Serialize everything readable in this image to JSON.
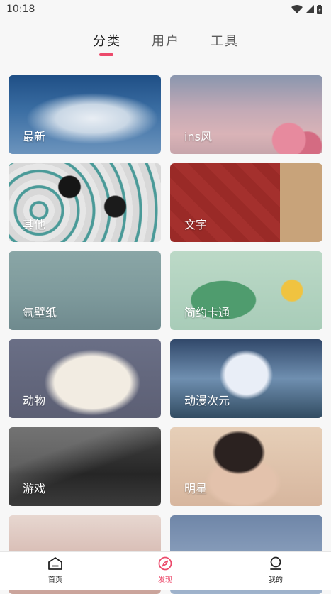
{
  "status_bar": {
    "time": "10:18"
  },
  "tabs": [
    {
      "label": "分类",
      "active": true
    },
    {
      "label": "用户",
      "active": false
    },
    {
      "label": "工具",
      "active": false
    }
  ],
  "colors": {
    "accent": "#ec4a6b"
  },
  "categories": [
    {
      "label": "最新"
    },
    {
      "label": "ins风"
    },
    {
      "label": "其他"
    },
    {
      "label": "文字"
    },
    {
      "label": "氩壁纸"
    },
    {
      "label": "简约卡通"
    },
    {
      "label": "动物"
    },
    {
      "label": "动漫次元"
    },
    {
      "label": "游戏"
    },
    {
      "label": "明星"
    },
    {
      "label": ""
    },
    {
      "label": ""
    }
  ],
  "bottom_nav": [
    {
      "label": "首页",
      "icon": "home-icon",
      "active": false
    },
    {
      "label": "发现",
      "icon": "compass-icon",
      "active": true
    },
    {
      "label": "我的",
      "icon": "user-icon",
      "active": false
    }
  ]
}
